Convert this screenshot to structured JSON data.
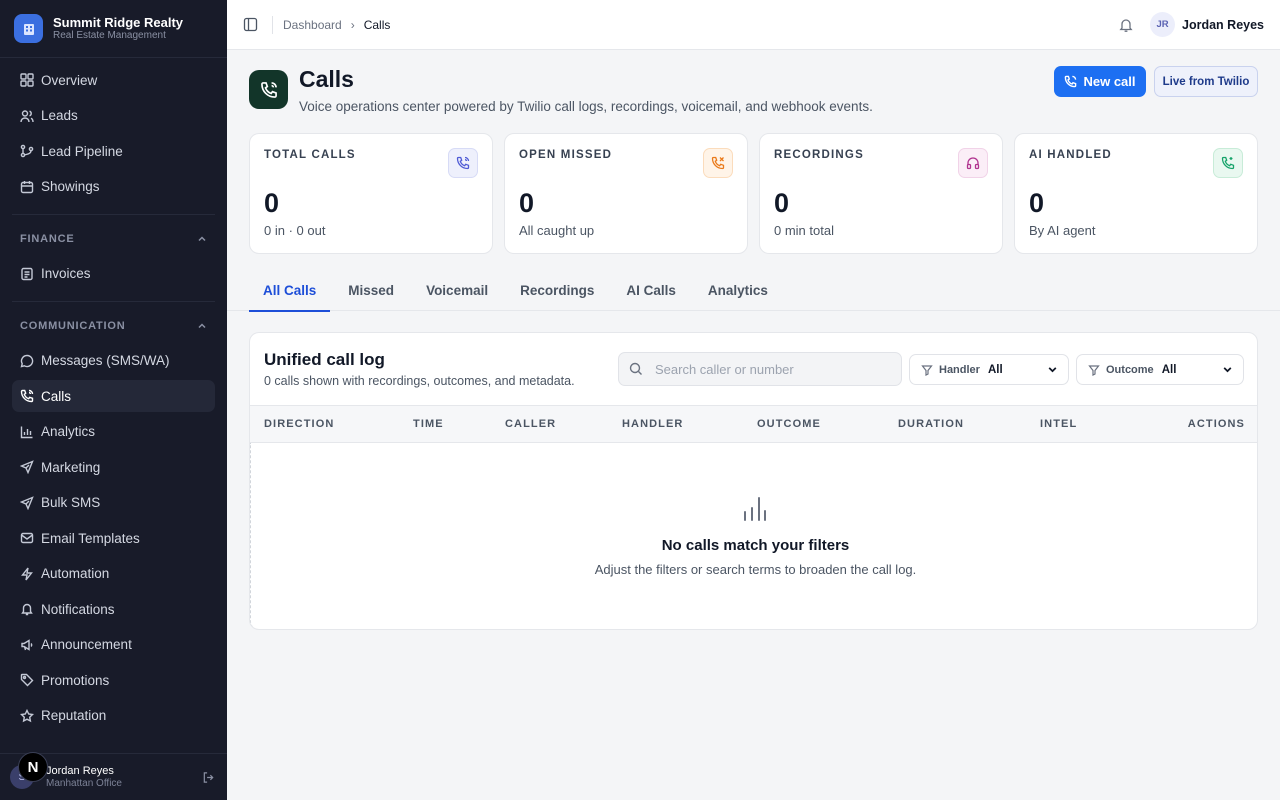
{
  "brand": {
    "title": "Summit Ridge Realty",
    "subtitle": "Real Estate Management"
  },
  "sidebar": {
    "main_items": [
      {
        "label": "Overview",
        "icon": "grid-icon"
      },
      {
        "label": "Leads",
        "icon": "users-icon"
      },
      {
        "label": "Lead Pipeline",
        "icon": "pipeline-icon"
      },
      {
        "label": "Showings",
        "icon": "calendar-icon"
      }
    ],
    "finance": {
      "label": "FINANCE",
      "items": [
        {
          "label": "Invoices",
          "icon": "receipt-icon"
        }
      ]
    },
    "communication": {
      "label": "COMMUNICATION",
      "items": [
        {
          "label": "Messages (SMS/WA)",
          "icon": "message-icon"
        },
        {
          "label": "Calls",
          "icon": "phone-icon",
          "active": true
        },
        {
          "label": "Analytics",
          "icon": "bar-chart-icon"
        },
        {
          "label": "Marketing",
          "icon": "send-icon"
        },
        {
          "label": "Bulk SMS",
          "icon": "send-icon"
        },
        {
          "label": "Email Templates",
          "icon": "mail-icon"
        },
        {
          "label": "Automation",
          "icon": "zap-icon"
        },
        {
          "label": "Notifications",
          "icon": "bell-icon"
        },
        {
          "label": "Announcement",
          "icon": "megaphone-icon"
        },
        {
          "label": "Promotions",
          "icon": "tag-icon"
        },
        {
          "label": "Reputation",
          "icon": "star-icon"
        }
      ]
    },
    "footer": {
      "name": "Jordan Reyes",
      "office": "Manhattan Office",
      "avatar_letter": "S",
      "badge": "N"
    }
  },
  "topbar": {
    "breadcrumb": [
      "Dashboard",
      "Calls"
    ],
    "user": {
      "initials": "JR",
      "name": "Jordan Reyes"
    }
  },
  "header": {
    "title": "Calls",
    "subtitle": "Voice operations center powered by Twilio call logs, recordings, voicemail, and webhook events.",
    "primary_button": "New call",
    "secondary_button": "Live from Twilio"
  },
  "stats": [
    {
      "label": "TOTAL CALLS",
      "value": "0",
      "note": "0 in · 0 out",
      "icon": "phone-icon",
      "color": "#4f5bd5"
    },
    {
      "label": "OPEN MISSED",
      "value": "0",
      "note": "All caught up",
      "icon": "phone-missed-icon",
      "color": "#ea7a1a"
    },
    {
      "label": "RECORDINGS",
      "value": "0",
      "note": "0 min total",
      "icon": "headphones-icon",
      "color": "#b0338f"
    },
    {
      "label": "AI HANDLED",
      "value": "0",
      "note": "By AI agent",
      "icon": "ai-phone-icon",
      "color": "#16a36a"
    }
  ],
  "tabs": [
    "All Calls",
    "Missed",
    "Voicemail",
    "Recordings",
    "AI Calls",
    "Analytics"
  ],
  "call_log": {
    "title": "Unified call log",
    "subtitle": "0 calls shown with recordings, outcomes, and metadata.",
    "search_placeholder": "Search caller or number",
    "filters": [
      {
        "label": "Handler",
        "value": "All"
      },
      {
        "label": "Outcome",
        "value": "All"
      }
    ],
    "columns": [
      "DIRECTION",
      "TIME",
      "CALLER",
      "HANDLER",
      "OUTCOME",
      "DURATION",
      "INTEL",
      "ACTIONS"
    ],
    "empty_title": "No calls match your filters",
    "empty_subtitle": "Adjust the filters or search terms to broaden the call log."
  },
  "colors": {
    "accent": "#1d6ff2",
    "sidebar_bg": "#181b29",
    "page_icon_bg": "#123529"
  }
}
